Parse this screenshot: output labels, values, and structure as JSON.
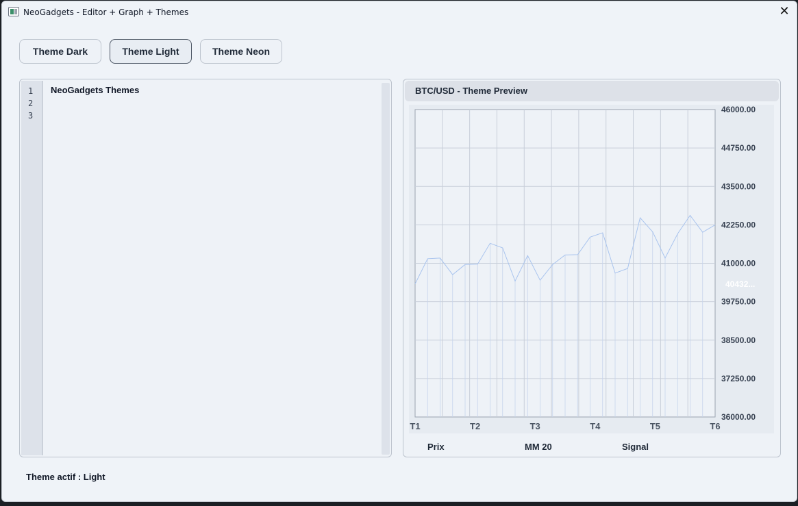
{
  "window": {
    "title": "NeoGadgets - Editor + Graph + Themes",
    "close_glyph": "✕"
  },
  "theme_buttons": [
    {
      "label": "Theme Dark",
      "active": false
    },
    {
      "label": "Theme Light",
      "active": true
    },
    {
      "label": "Theme Neon",
      "active": false
    }
  ],
  "editor": {
    "line_numbers": [
      "1",
      "2",
      "3"
    ],
    "lines": [
      "NeoGadgets Themes",
      "",
      ""
    ]
  },
  "chart_panel": {
    "title": "BTC/USD - Theme Preview",
    "legend": [
      "Prix",
      "MM 20",
      "Signal"
    ]
  },
  "status": {
    "text": "Theme actif : Light"
  },
  "colors": {
    "accent_line": "#a9c4ee",
    "grid": "#c7ced9",
    "axis": "#9aa3af",
    "text": "#1f2937",
    "current_value_label": "#ffffff"
  },
  "chart_data": {
    "type": "line",
    "title": "BTC/USD - Theme Preview",
    "x_tick_labels": [
      "T1",
      "T2",
      "T3",
      "T4",
      "T5",
      "T6"
    ],
    "y_tick_labels": [
      "46000.00",
      "44750.00",
      "43500.00",
      "42250.00",
      "41000.00",
      "39750.00",
      "38500.00",
      "37250.00",
      "36000.00"
    ],
    "ylim": [
      36000,
      46000
    ],
    "grid": true,
    "current_value_label": "40432...",
    "series": [
      {
        "name": "Prix",
        "values": [
          40330,
          41150,
          41170,
          40630,
          40960,
          40970,
          41650,
          41500,
          40420,
          41250,
          40450,
          40960,
          41270,
          41280,
          41850,
          41990,
          40680,
          40830,
          42480,
          42020,
          41170,
          41960,
          42560,
          42010,
          42250
        ]
      }
    ]
  }
}
